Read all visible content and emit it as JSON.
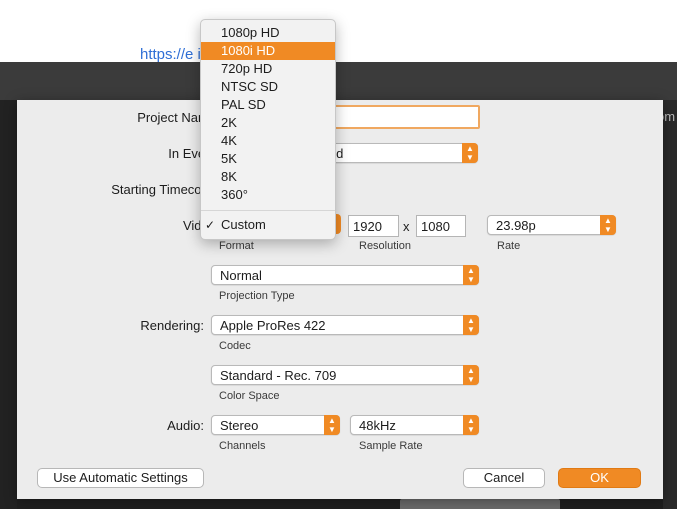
{
  "background": {
    "link_text": "https://e           iki/1080i",
    "right_fragment": "om"
  },
  "sheet": {
    "labels": {
      "project_name": "Project Name",
      "in_event": "In Event",
      "starting_timecode": "Starting Timecode",
      "video": "Video",
      "rendering": "Rendering:",
      "audio": "Audio:"
    },
    "project_name_value": "",
    "in_event_value": "eld",
    "video": {
      "resolution_width": "1920",
      "resolution_x": "x",
      "resolution_height": "1080",
      "rate": "23.98p",
      "format_label": "Format",
      "resolution_label": "Resolution",
      "rate_label": "Rate"
    },
    "projection": {
      "value": "Normal",
      "label": "Projection Type"
    },
    "codec": {
      "value": "Apple ProRes 422",
      "label": "Codec"
    },
    "color_space": {
      "value": "Standard - Rec. 709",
      "label": "Color Space"
    },
    "audio": {
      "channels_value": "Stereo",
      "channels_label": "Channels",
      "sample_rate_value": "48kHz",
      "sample_rate_label": "Sample Rate"
    },
    "buttons": {
      "auto_settings": "Use Automatic Settings",
      "cancel": "Cancel",
      "ok": "OK"
    }
  },
  "format_menu": {
    "items": [
      "1080p HD",
      "1080i HD",
      "720p HD",
      "NTSC SD",
      "PAL SD",
      "2K",
      "4K",
      "5K",
      "8K",
      "360°"
    ],
    "highlighted": "1080i HD",
    "checked_item": "Custom",
    "check_glyph": "✓"
  },
  "colors": {
    "accent": "#f08a24",
    "sheet_bg": "#ececec"
  }
}
